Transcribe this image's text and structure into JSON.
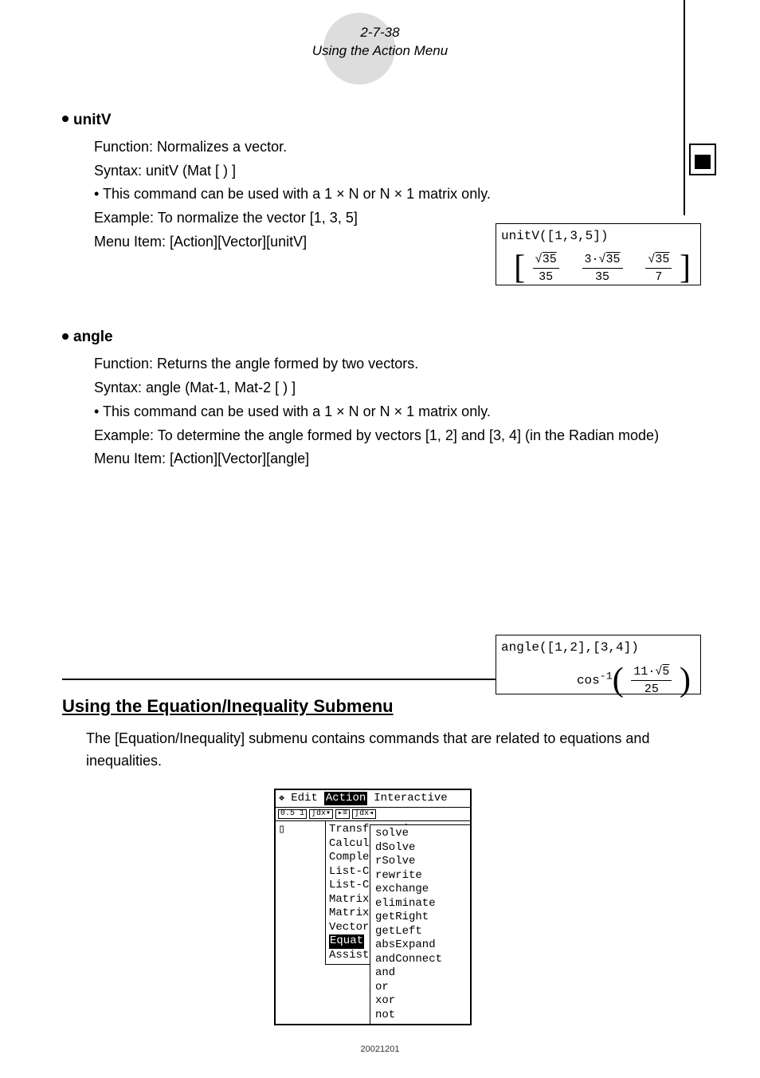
{
  "header": {
    "page_ref": "2-7-38",
    "title": "Using the Action Menu"
  },
  "entries": [
    {
      "name": "unitV",
      "function": "Function: Normalizes a vector.",
      "syntax": "Syntax: unitV (Mat [ ) ]",
      "note": "This command can be used with a 1 × N or N × 1 matrix only.",
      "example": "Example: To normalize the vector [1, 3, 5]",
      "menu": "Menu Item: [Action][Vector][unitV]",
      "calc_input": "unitV([1,3,5])",
      "calc_output_tex": "[ √35/35   3·√35/35   √35/7 ]"
    },
    {
      "name": "angle",
      "function": "Function: Returns the angle formed by two vectors.",
      "syntax": "Syntax: angle (Mat-1, Mat-2 [ ) ]",
      "note": "This command can be used with a 1 × N or N × 1 matrix only.",
      "example": "Example: To determine the angle formed by vectors [1, 2] and [3, 4] (in the Radian mode)",
      "menu": "Menu Item: [Action][Vector][angle]",
      "calc_input": "angle([1,2],[3,4])",
      "calc_output_tex": "cos⁻¹( 11·√5 / 25 )"
    }
  ],
  "section": {
    "heading": "Using the Equation/Inequality Submenu",
    "description": "The [Equation/Inequality] submenu contains commands that are related to equations and inequalities."
  },
  "menu_screenshot": {
    "menubar": {
      "chevron": "❖",
      "items": [
        "Edit",
        "Action",
        "Interactive"
      ],
      "selected": "Action"
    },
    "action_items": [
      "Transformation",
      "Calculation",
      "Complex",
      "List-Create",
      "List-Calculation",
      "Matrix-Create",
      "Matrix-Calculation",
      "Vector",
      "Equation/Inequality",
      "Assistant"
    ],
    "side_labels": {
      "equat": "Equat",
      "assist": "Assist"
    },
    "submenu": [
      "solve",
      "dSolve",
      "rSolve",
      "rewrite",
      "exchange",
      "eliminate",
      "getRight",
      "getLeft",
      "absExpand",
      "andConnect",
      "and",
      "or",
      "xor",
      "not"
    ]
  },
  "footer": "20021201"
}
